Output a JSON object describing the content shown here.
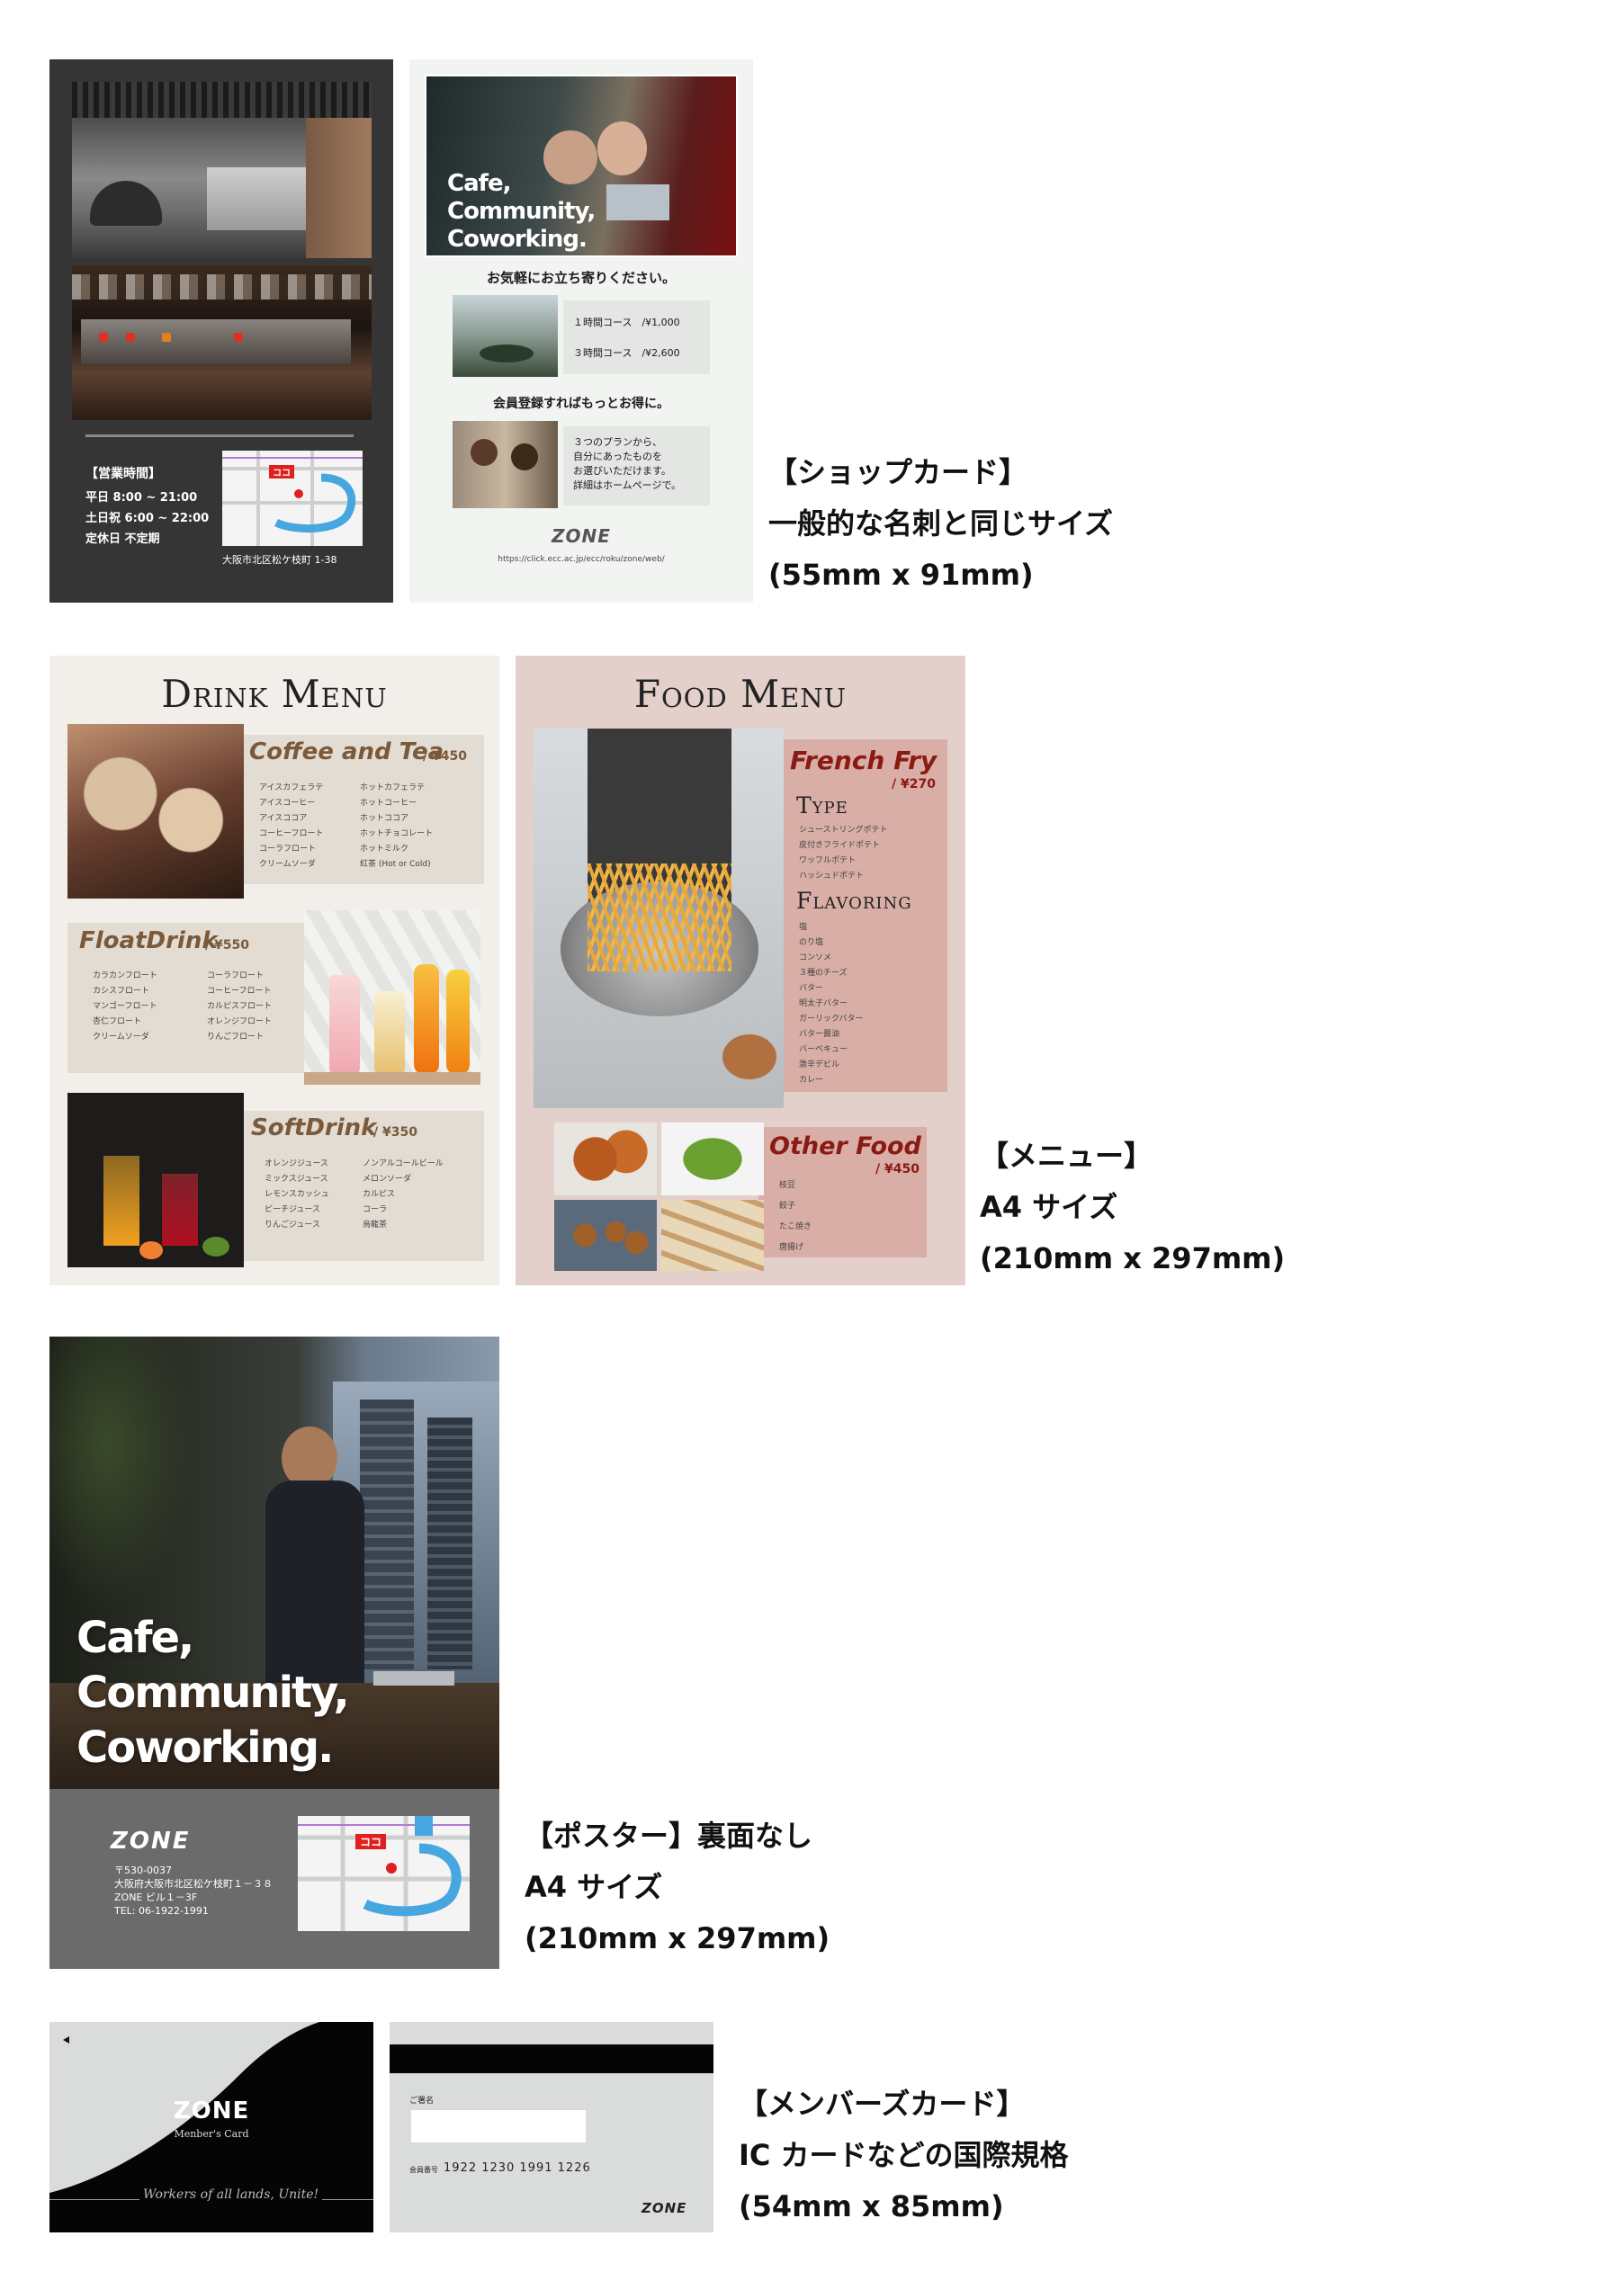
{
  "shopcard": {
    "hours_title": "【営業時間】",
    "hours": [
      "平日 8:00 ~ 21:00",
      "土日祝 6:00 ~ 22:00",
      "定休日 不定期"
    ],
    "address": "大阪市北区松ケ枝町 1-38",
    "map_marker": "ココ",
    "headline": [
      "Cafe,",
      "Community,",
      "Coworking."
    ],
    "welcome": "お気軽にお立ち寄りください。",
    "course_1": "１時間コース　/¥1,000",
    "course_2": "３時間コース　/¥2,600",
    "member_heading": "会員登録すればもっとお得に。",
    "member_text": [
      "３つのプランから、",
      "自分にあったものを",
      "お選びいただけます。",
      "詳細はホームページで。"
    ],
    "logo": "ZONE",
    "url": "https://click.ecc.ac.jp/ecc/roku/zone/web/"
  },
  "caption_shopcard": [
    "【ショップカード】",
    "一般的な名刺と同じサイズ",
    "(55mm x 91mm)"
  ],
  "drink_menu": {
    "title": "Drink Menu",
    "coffee": {
      "name": "Coffee and Tea",
      "price": "/ ¥450",
      "col1": [
        "アイスカフェラテ",
        "アイスコーヒー",
        "アイスココア",
        "コーヒーフロート",
        "コーラフロート",
        "クリームソーダ"
      ],
      "col2": [
        "ホットカフェラテ",
        "ホットコーヒー",
        "ホットココア",
        "ホットチョコレート",
        "ホットミルク",
        "紅茶 (Hot or Cold)"
      ]
    },
    "float": {
      "name": "FloatDrink",
      "price": "/ ¥550",
      "col1": [
        "カラカンフロート",
        "カシスフロート",
        "マンゴーフロート",
        "杏仁フロート",
        "クリームソーダ"
      ],
      "col2": [
        "コーラフロート",
        "コーヒーフロート",
        "カルピスフロート",
        "オレンジフロート",
        "りんごフロート"
      ]
    },
    "soft": {
      "name": "SoftDrink",
      "price": "/ ¥350",
      "col1": [
        "オレンジジュース",
        "ミックスジュース",
        "レモンスカッシュ",
        "ピーチジュース",
        "りんごジュース"
      ],
      "col2": [
        "ノンアルコールビール",
        "メロンソーダ",
        "カルピス",
        "コーラ",
        "烏龍茶"
      ]
    }
  },
  "food_menu": {
    "title": "Food Menu",
    "fry": {
      "name": "French Fry",
      "price": "/ ¥270",
      "type_title": "Type",
      "types": [
        "シューストリングポテト",
        "皮付きフライドポテト",
        "ワッフルポテト",
        "ハッシュドポテト"
      ],
      "flavor_title": "Flavoring",
      "flavors": [
        "塩",
        "のり塩",
        "コンソメ",
        "３種のチーズ",
        "バター",
        "明太子バター",
        "ガーリックバター",
        "バター醤油",
        "バーベキュー",
        "激辛デビル",
        "カレー"
      ]
    },
    "other": {
      "name": "Other Food",
      "price": "/ ¥450",
      "items": [
        "枝豆",
        "餃子",
        "たこ焼き",
        "唐揚げ"
      ]
    }
  },
  "caption_menu": [
    "【メニュー】",
    "A4 サイズ",
    "(210mm x 297mm)"
  ],
  "poster": {
    "headline": [
      "Cafe,",
      "Community,",
      "Coworking."
    ],
    "logo": "ZONE",
    "address_lines": [
      "〒530-0037",
      "大阪府大阪市北区松ケ枝町１－３８",
      "ZONE ビル１－3F",
      "TEL: 06-1922-1991"
    ],
    "map_marker": "ココ"
  },
  "caption_poster": [
    "【ポスター】裏面なし",
    "A4 サイズ",
    "(210mm x 297mm)"
  ],
  "member_card": {
    "logo": "ZONE",
    "subtitle": "Menber's Card",
    "slogan": "Workers of all lands, Unite!",
    "name_label": "ご署名",
    "number_label": "会員番号",
    "number": "1922 1230 1991 1226",
    "back_logo": "ZONE"
  },
  "caption_member": [
    "【メンバーズカード】",
    "IC カードなどの国際規格",
    "(54mm x 85mm)"
  ]
}
